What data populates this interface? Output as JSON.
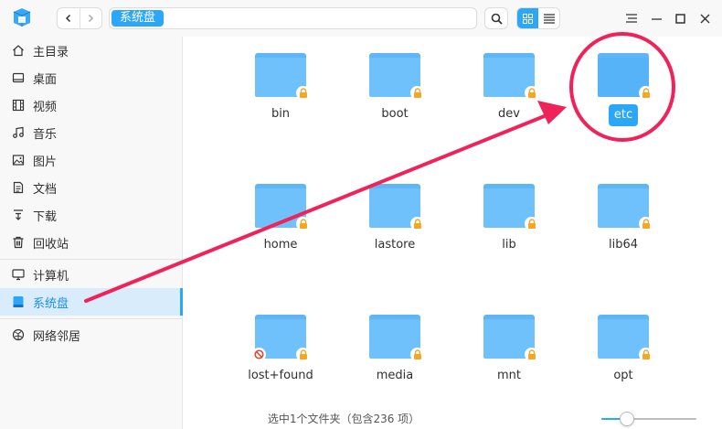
{
  "window": {
    "nav_back_icon": "chevron-left-icon",
    "nav_forward_icon": "chevron-right-icon"
  },
  "address": {
    "crumb": "系统盘"
  },
  "sidebar": {
    "items": [
      {
        "label": "主目录",
        "icon": "home-icon"
      },
      {
        "label": "桌面",
        "icon": "desktop-icon"
      },
      {
        "label": "视频",
        "icon": "video-icon"
      },
      {
        "label": "音乐",
        "icon": "music-icon"
      },
      {
        "label": "图片",
        "icon": "picture-icon"
      },
      {
        "label": "文档",
        "icon": "document-icon"
      },
      {
        "label": "下载",
        "icon": "download-icon"
      },
      {
        "label": "回收站",
        "icon": "trash-icon"
      },
      {
        "label": "计算机",
        "icon": "computer-icon"
      },
      {
        "label": "系统盘",
        "icon": "disk-icon",
        "active": true
      },
      {
        "label": "网络邻居",
        "icon": "network-icon"
      }
    ]
  },
  "folders": [
    {
      "name": "bin",
      "locked": true
    },
    {
      "name": "boot",
      "locked": true
    },
    {
      "name": "dev",
      "locked": true
    },
    {
      "name": "etc",
      "locked": true,
      "selected": true
    },
    {
      "name": "home",
      "locked": true
    },
    {
      "name": "lastore",
      "locked": true
    },
    {
      "name": "lib",
      "locked": true
    },
    {
      "name": "lib64",
      "locked": true
    },
    {
      "name": "lost+found",
      "locked": true,
      "no_access": true
    },
    {
      "name": "media",
      "locked": true
    },
    {
      "name": "mnt",
      "locked": true
    },
    {
      "name": "opt",
      "locked": true
    }
  ],
  "status": {
    "text": "选中1个文件夹（包含236 项）",
    "zoom_fraction": 0.27
  },
  "colors": {
    "accent": "#2ca7f8",
    "folder": "#6fc1fb",
    "annotation": "#f0225a",
    "lock": "#f5a623"
  }
}
